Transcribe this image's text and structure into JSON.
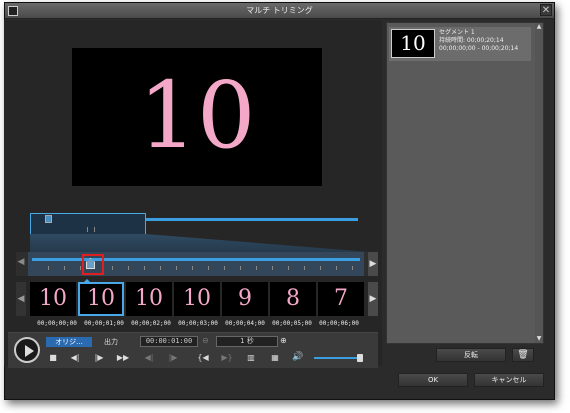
{
  "window": {
    "title": "マルチ トリミング",
    "close_label": "✕"
  },
  "preview": {
    "frame_number": "10"
  },
  "timeline": {
    "left_arrow": "◀",
    "right_arrow": "▶"
  },
  "thumbnails": {
    "items": [
      "10",
      "10",
      "10",
      "10",
      "9",
      "8",
      "7"
    ],
    "selected_index": 1,
    "timecodes": [
      "00;00;00;00",
      "00;00;01;00",
      "00;00;02;00",
      "00;00;03;00",
      "00;00;04;00",
      "00;00;05;00",
      "00;00;06;00"
    ]
  },
  "controls": {
    "tab_original": "オリジ...",
    "tab_output": "出力",
    "time_value": "00:00:01:00",
    "zoom_value": "1 秒",
    "stop_icon": "■",
    "prev_frame_icon": "◀|",
    "next_frame_icon": "|▶",
    "fast_forward_icon": "▶▶",
    "mark_in_icon": "{◀",
    "mark_out_icon": "▶}",
    "volume_icon": "🔊",
    "zoom_out_icon": "⊖",
    "zoom_in_icon": "⊕",
    "volume_level": 1.0
  },
  "segments": {
    "items": [
      {
        "thumb": "10",
        "name": "セグメント 1",
        "duration": "持続時間: 00;00;20;14",
        "range": "00;00;00;00 - 00;00;20;14"
      }
    ]
  },
  "buttons": {
    "reverse": "反転",
    "delete_icon": "🗑",
    "ok": "OK",
    "cancel": "キャンセル"
  },
  "colors": {
    "accent": "#3a9ee0",
    "playhead_highlight": "#e02020",
    "frame_text": "#f4a8c8"
  }
}
